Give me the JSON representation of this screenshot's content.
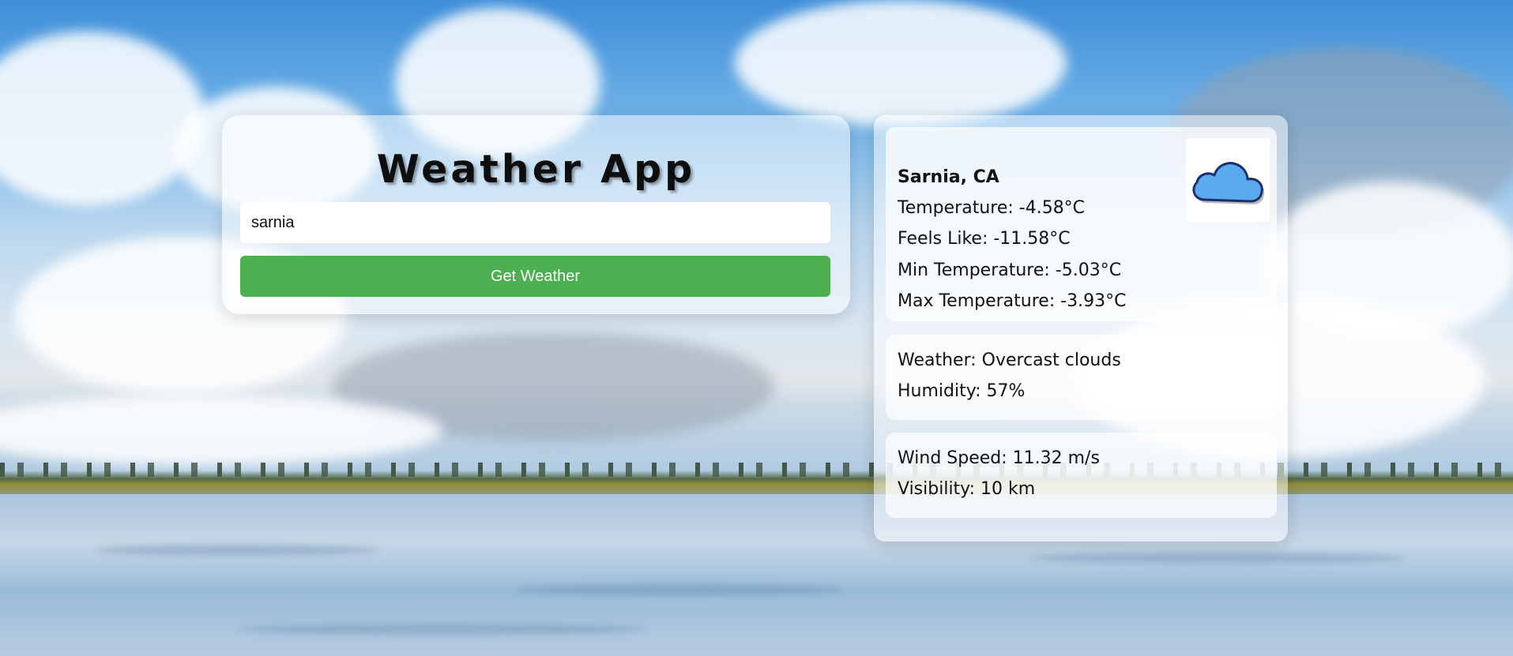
{
  "app": {
    "title": "Weather App"
  },
  "search": {
    "value": "sarnia",
    "button_label": "Get Weather"
  },
  "weather": {
    "location": "Sarnia, CA",
    "temperature": "Temperature: -4.58°C",
    "feels_like": "Feels Like: -11.58°C",
    "min_temp": "Min Temperature: -5.03°C",
    "max_temp": "Max Temperature: -3.93°C",
    "condition": "Weather: Overcast clouds",
    "humidity": "Humidity: 57%",
    "wind_speed": "Wind Speed: 11.32 m/s",
    "visibility": "Visibility: 10 km",
    "icon": "cloud-icon"
  },
  "colors": {
    "button": "#4caf50",
    "button_text": "#ffffff",
    "cloud_icon_fill": "#5aaaf0",
    "cloud_icon_outline": "#1a2f6b"
  }
}
